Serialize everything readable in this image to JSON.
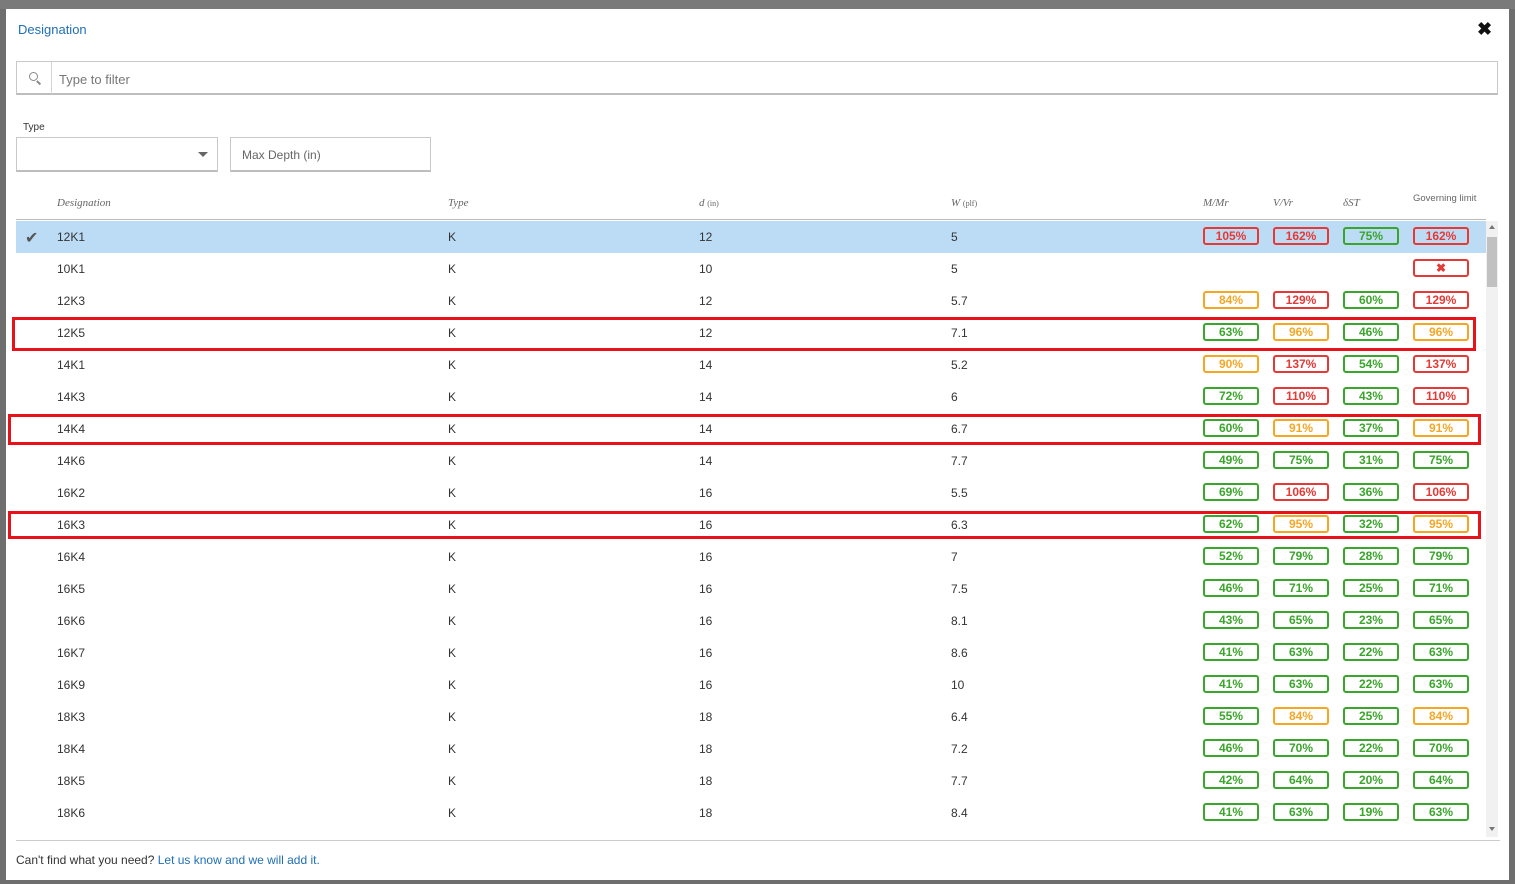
{
  "dialog": {
    "title": "Designation",
    "close_icon": "close-icon"
  },
  "search": {
    "placeholder": "Type to filter",
    "icon": "search-icon"
  },
  "filters": {
    "type_label": "Type",
    "type_value": "",
    "max_depth_placeholder": "Max Depth (in)"
  },
  "columns": {
    "designation": "Designation",
    "type": "Type",
    "d": "d",
    "d_unit": "(in)",
    "w": "W",
    "w_unit": "(plf)",
    "m": "M/Mr",
    "v": "V/Vr",
    "delta": "δST",
    "governing": "Governing limit"
  },
  "colors": {
    "red": "#e53935",
    "orange": "#f5a623",
    "green": "#3aa52b",
    "selected_row": "#bcdcf6",
    "highlight_border": "#e8121b"
  },
  "rows": [
    {
      "designation": "12K1",
      "type": "K",
      "d": "12",
      "w": "5",
      "m": "105%",
      "m_s": "red",
      "v": "162%",
      "v_s": "red",
      "s": "75%",
      "s_s": "green",
      "g": "162%",
      "g_s": "red",
      "selected": true
    },
    {
      "designation": "10K1",
      "type": "K",
      "d": "10",
      "w": "5",
      "m": "",
      "m_s": "",
      "v": "",
      "v_s": "",
      "s": "",
      "s_s": "",
      "g": "✖",
      "g_s": "red"
    },
    {
      "designation": "12K3",
      "type": "K",
      "d": "12",
      "w": "5.7",
      "m": "84%",
      "m_s": "orange",
      "v": "129%",
      "v_s": "red",
      "s": "60%",
      "s_s": "green",
      "g": "129%",
      "g_s": "red"
    },
    {
      "designation": "12K5",
      "type": "K",
      "d": "12",
      "w": "7.1",
      "m": "63%",
      "m_s": "green",
      "v": "96%",
      "v_s": "orange",
      "s": "46%",
      "s_s": "green",
      "g": "96%",
      "g_s": "orange",
      "highlight": true
    },
    {
      "designation": "14K1",
      "type": "K",
      "d": "14",
      "w": "5.2",
      "m": "90%",
      "m_s": "orange",
      "v": "137%",
      "v_s": "red",
      "s": "54%",
      "s_s": "green",
      "g": "137%",
      "g_s": "red"
    },
    {
      "designation": "14K3",
      "type": "K",
      "d": "14",
      "w": "6",
      "m": "72%",
      "m_s": "green",
      "v": "110%",
      "v_s": "red",
      "s": "43%",
      "s_s": "green",
      "g": "110%",
      "g_s": "red"
    },
    {
      "designation": "14K4",
      "type": "K",
      "d": "14",
      "w": "6.7",
      "m": "60%",
      "m_s": "green",
      "v": "91%",
      "v_s": "orange",
      "s": "37%",
      "s_s": "green",
      "g": "91%",
      "g_s": "orange",
      "highlight": true
    },
    {
      "designation": "14K6",
      "type": "K",
      "d": "14",
      "w": "7.7",
      "m": "49%",
      "m_s": "green",
      "v": "75%",
      "v_s": "green",
      "s": "31%",
      "s_s": "green",
      "g": "75%",
      "g_s": "green"
    },
    {
      "designation": "16K2",
      "type": "K",
      "d": "16",
      "w": "5.5",
      "m": "69%",
      "m_s": "green",
      "v": "106%",
      "v_s": "red",
      "s": "36%",
      "s_s": "green",
      "g": "106%",
      "g_s": "red"
    },
    {
      "designation": "16K3",
      "type": "K",
      "d": "16",
      "w": "6.3",
      "m": "62%",
      "m_s": "green",
      "v": "95%",
      "v_s": "orange",
      "s": "32%",
      "s_s": "green",
      "g": "95%",
      "g_s": "orange",
      "highlight": true
    },
    {
      "designation": "16K4",
      "type": "K",
      "d": "16",
      "w": "7",
      "m": "52%",
      "m_s": "green",
      "v": "79%",
      "v_s": "green",
      "s": "28%",
      "s_s": "green",
      "g": "79%",
      "g_s": "green"
    },
    {
      "designation": "16K5",
      "type": "K",
      "d": "16",
      "w": "7.5",
      "m": "46%",
      "m_s": "green",
      "v": "71%",
      "v_s": "green",
      "s": "25%",
      "s_s": "green",
      "g": "71%",
      "g_s": "green"
    },
    {
      "designation": "16K6",
      "type": "K",
      "d": "16",
      "w": "8.1",
      "m": "43%",
      "m_s": "green",
      "v": "65%",
      "v_s": "green",
      "s": "23%",
      "s_s": "green",
      "g": "65%",
      "g_s": "green"
    },
    {
      "designation": "16K7",
      "type": "K",
      "d": "16",
      "w": "8.6",
      "m": "41%",
      "m_s": "green",
      "v": "63%",
      "v_s": "green",
      "s": "22%",
      "s_s": "green",
      "g": "63%",
      "g_s": "green"
    },
    {
      "designation": "16K9",
      "type": "K",
      "d": "16",
      "w": "10",
      "m": "41%",
      "m_s": "green",
      "v": "63%",
      "v_s": "green",
      "s": "22%",
      "s_s": "green",
      "g": "63%",
      "g_s": "green"
    },
    {
      "designation": "18K3",
      "type": "K",
      "d": "18",
      "w": "6.4",
      "m": "55%",
      "m_s": "green",
      "v": "84%",
      "v_s": "orange",
      "s": "25%",
      "s_s": "green",
      "g": "84%",
      "g_s": "orange"
    },
    {
      "designation": "18K4",
      "type": "K",
      "d": "18",
      "w": "7.2",
      "m": "46%",
      "m_s": "green",
      "v": "70%",
      "v_s": "green",
      "s": "22%",
      "s_s": "green",
      "g": "70%",
      "g_s": "green"
    },
    {
      "designation": "18K5",
      "type": "K",
      "d": "18",
      "w": "7.7",
      "m": "42%",
      "m_s": "green",
      "v": "64%",
      "v_s": "green",
      "s": "20%",
      "s_s": "green",
      "g": "64%",
      "g_s": "green"
    },
    {
      "designation": "18K6",
      "type": "K",
      "d": "18",
      "w": "8.4",
      "m": "41%",
      "m_s": "green",
      "v": "63%",
      "v_s": "green",
      "s": "19%",
      "s_s": "green",
      "g": "63%",
      "g_s": "green"
    }
  ],
  "footer": {
    "text": "Can't find what you need? ",
    "link": "Let us know and we will add it."
  }
}
